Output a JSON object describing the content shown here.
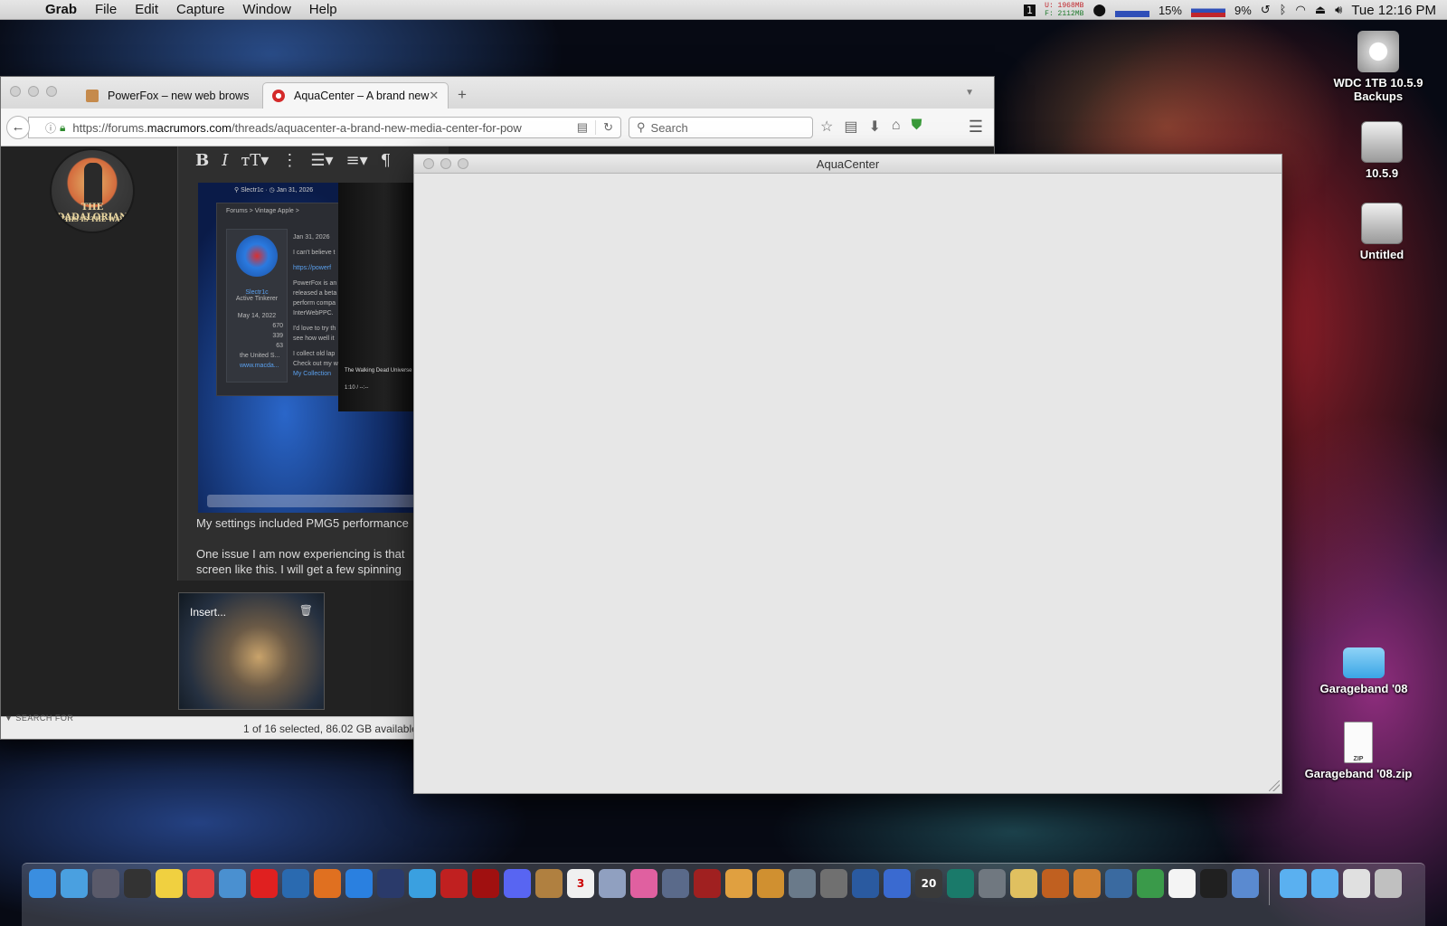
{
  "menubar": {
    "app": "Grab",
    "items": [
      "File",
      "Edit",
      "Capture",
      "Window",
      "Help"
    ],
    "status": {
      "mem_used": "U: 1968MB",
      "mem_free": "F: 2112MB",
      "cpu1": "15%",
      "cpu2": "9%",
      "clock": "Tue 12:16 PM"
    }
  },
  "desktop": {
    "icons": [
      {
        "label": "WDC 1TB 10.5.9 Backups",
        "icon": "time-machine-drive-icon"
      },
      {
        "label": "10.5.9",
        "icon": "hard-drive-icon"
      },
      {
        "label": "Untitled",
        "icon": "hard-drive-icon"
      },
      {
        "label": "Garageband '08",
        "icon": "folder-icon"
      },
      {
        "label": "Garageband '08.zip",
        "icon": "zip-archive-icon"
      }
    ]
  },
  "browser": {
    "tabs": [
      {
        "label": "PowerFox – new web brows",
        "active": false
      },
      {
        "label": "AquaCenter – A brand new",
        "active": true
      }
    ],
    "url": {
      "prefix": "https://forums.",
      "domain": "macrumors.com",
      "path": "/threads/aquacenter-a-brand-new-media-center-for-pow"
    },
    "search_placeholder": "Search",
    "avatar_text": "THE DADALORIAN",
    "avatar_subtext": "THIS IS THE WAY",
    "embedded_screenshot": {
      "breadcrumb": "Forums  >  Vintage Apple  >",
      "author": "Slectr1c",
      "author_title": "Active Tinkerer",
      "post_date": "Jan 31, 2026",
      "join_date": "May 14, 2022",
      "stats": [
        "670",
        "339",
        "63"
      ],
      "location": "the United S...",
      "website": "www.macda...",
      "post_lines": [
        "I can't believe t",
        "https://powerf",
        "PowerFox is an",
        "released a beta",
        "perform compa",
        "InterWebPPC.",
        "I'd love to try th",
        "see how well it",
        "I collect old lap",
        "Check out my w",
        "My Collection"
      ],
      "video_title": "The Walking Dead Universe",
      "video_time": "1:10 / --:--"
    },
    "post_text": [
      "My settings included PMG5 performance",
      "One issue I am now experiencing is that",
      "screen like this. I will get a few spinning"
    ],
    "thumb_label": "Insert...",
    "finder_section": "SEARCH FOR",
    "finder_status": "1 of 16 selected, 86.02 GB available"
  },
  "aquacenter": {
    "title": "AquaCenter"
  },
  "dock": {
    "items": [
      "finder-icon",
      "safari-compass-icon",
      "launchpad-icon",
      "dashboard-icon",
      "stickies-icon",
      "gmail-icon",
      "preview-icon",
      "youtube-icon",
      "network-icon",
      "firefox-icon",
      "safari-icon",
      "steam-icon",
      "messages-icon",
      "unreal-icon",
      "crosshair-icon",
      "discord-icon",
      "contacts-icon",
      "calendar-icon",
      "mail-icon",
      "itunes-icon",
      "mission-control-icon",
      "photo-booth-icon",
      "pages-icon",
      "iphoto-icon",
      "utility-icon",
      "archive-icon",
      "coda-icon",
      "bbedit-icon",
      "speed-icon",
      "time-machine-icon",
      "system-preferences-icon",
      "notes-icon",
      "garageband-icon",
      "keynote-icon",
      "grapher-icon",
      "numbers-icon",
      "textedit-icon",
      "terminal-icon",
      "xcode-icon",
      "applications-folder-icon",
      "downloads-folder-icon",
      "documents-icon",
      "trash-icon"
    ],
    "calendar_day": "3",
    "speed_value": "20"
  }
}
